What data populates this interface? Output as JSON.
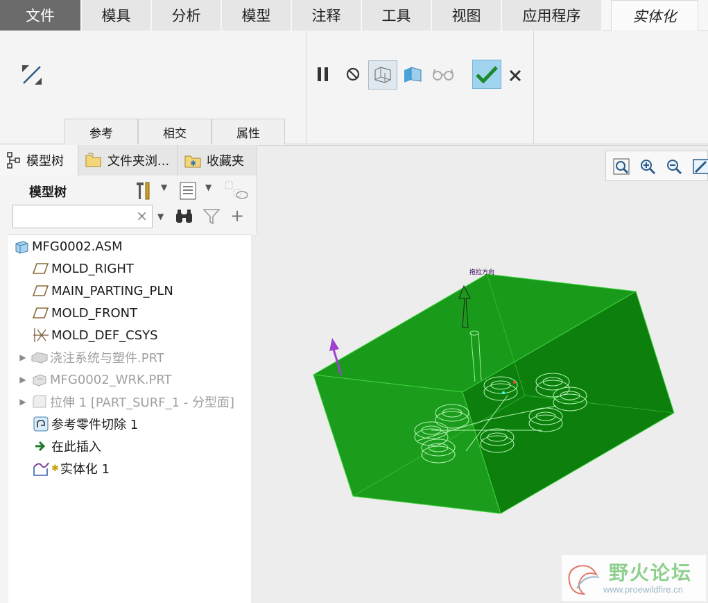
{
  "menu": {
    "tabs": [
      "文件",
      "模具",
      "分析",
      "模型",
      "注释",
      "工具",
      "视图",
      "应用程序"
    ],
    "active_tab": "实体化"
  },
  "ribbon": {
    "group_tabs": [
      "参考",
      "相交",
      "属性"
    ]
  },
  "panel": {
    "tabs": [
      "模型树",
      "文件夹浏...",
      "收藏夹"
    ],
    "tree_title": "模型树",
    "search_value": "",
    "search_clear": "×"
  },
  "tree": {
    "nodes": [
      {
        "label": "MFG0002.ASM",
        "icon": "assembly-icon",
        "dim": false,
        "expandable": false
      },
      {
        "label": "MOLD_RIGHT",
        "icon": "datum-plane-icon",
        "dim": false,
        "expandable": false
      },
      {
        "label": "MAIN_PARTING_PLN",
        "icon": "datum-plane-icon",
        "dim": false,
        "expandable": false
      },
      {
        "label": "MOLD_FRONT",
        "icon": "datum-plane-icon",
        "dim": false,
        "expandable": false
      },
      {
        "label": "MOLD_DEF_CSYS",
        "icon": "csys-icon",
        "dim": false,
        "expandable": false
      },
      {
        "label": "浇注系统与塑件.PRT",
        "icon": "part-icon",
        "dim": true,
        "expandable": true
      },
      {
        "label": "MFG0002_WRK.PRT",
        "icon": "workpiece-icon",
        "dim": true,
        "expandable": true
      },
      {
        "label": "拉伸 1 [PART_SURF_1 - 分型面]",
        "icon": "surface-icon",
        "dim": true,
        "expandable": true
      },
      {
        "label": "参考零件切除 1",
        "icon": "cutout-icon",
        "dim": false,
        "expandable": false
      },
      {
        "label": "在此插入",
        "icon": "insert-here-arrow-icon",
        "dim": false,
        "expandable": false
      },
      {
        "label": "实体化 1",
        "icon": "solidify-icon",
        "dim": false,
        "expandable": false
      }
    ]
  },
  "viewport": {
    "drag_label": "拖拉方向"
  },
  "watermark": {
    "name": "野火论坛",
    "url": "www.proewildfire.cn"
  },
  "colors": {
    "model_green": "#1a9a1a",
    "model_dark": "#0d7a0d",
    "accent_check": "#9fd3ee"
  }
}
